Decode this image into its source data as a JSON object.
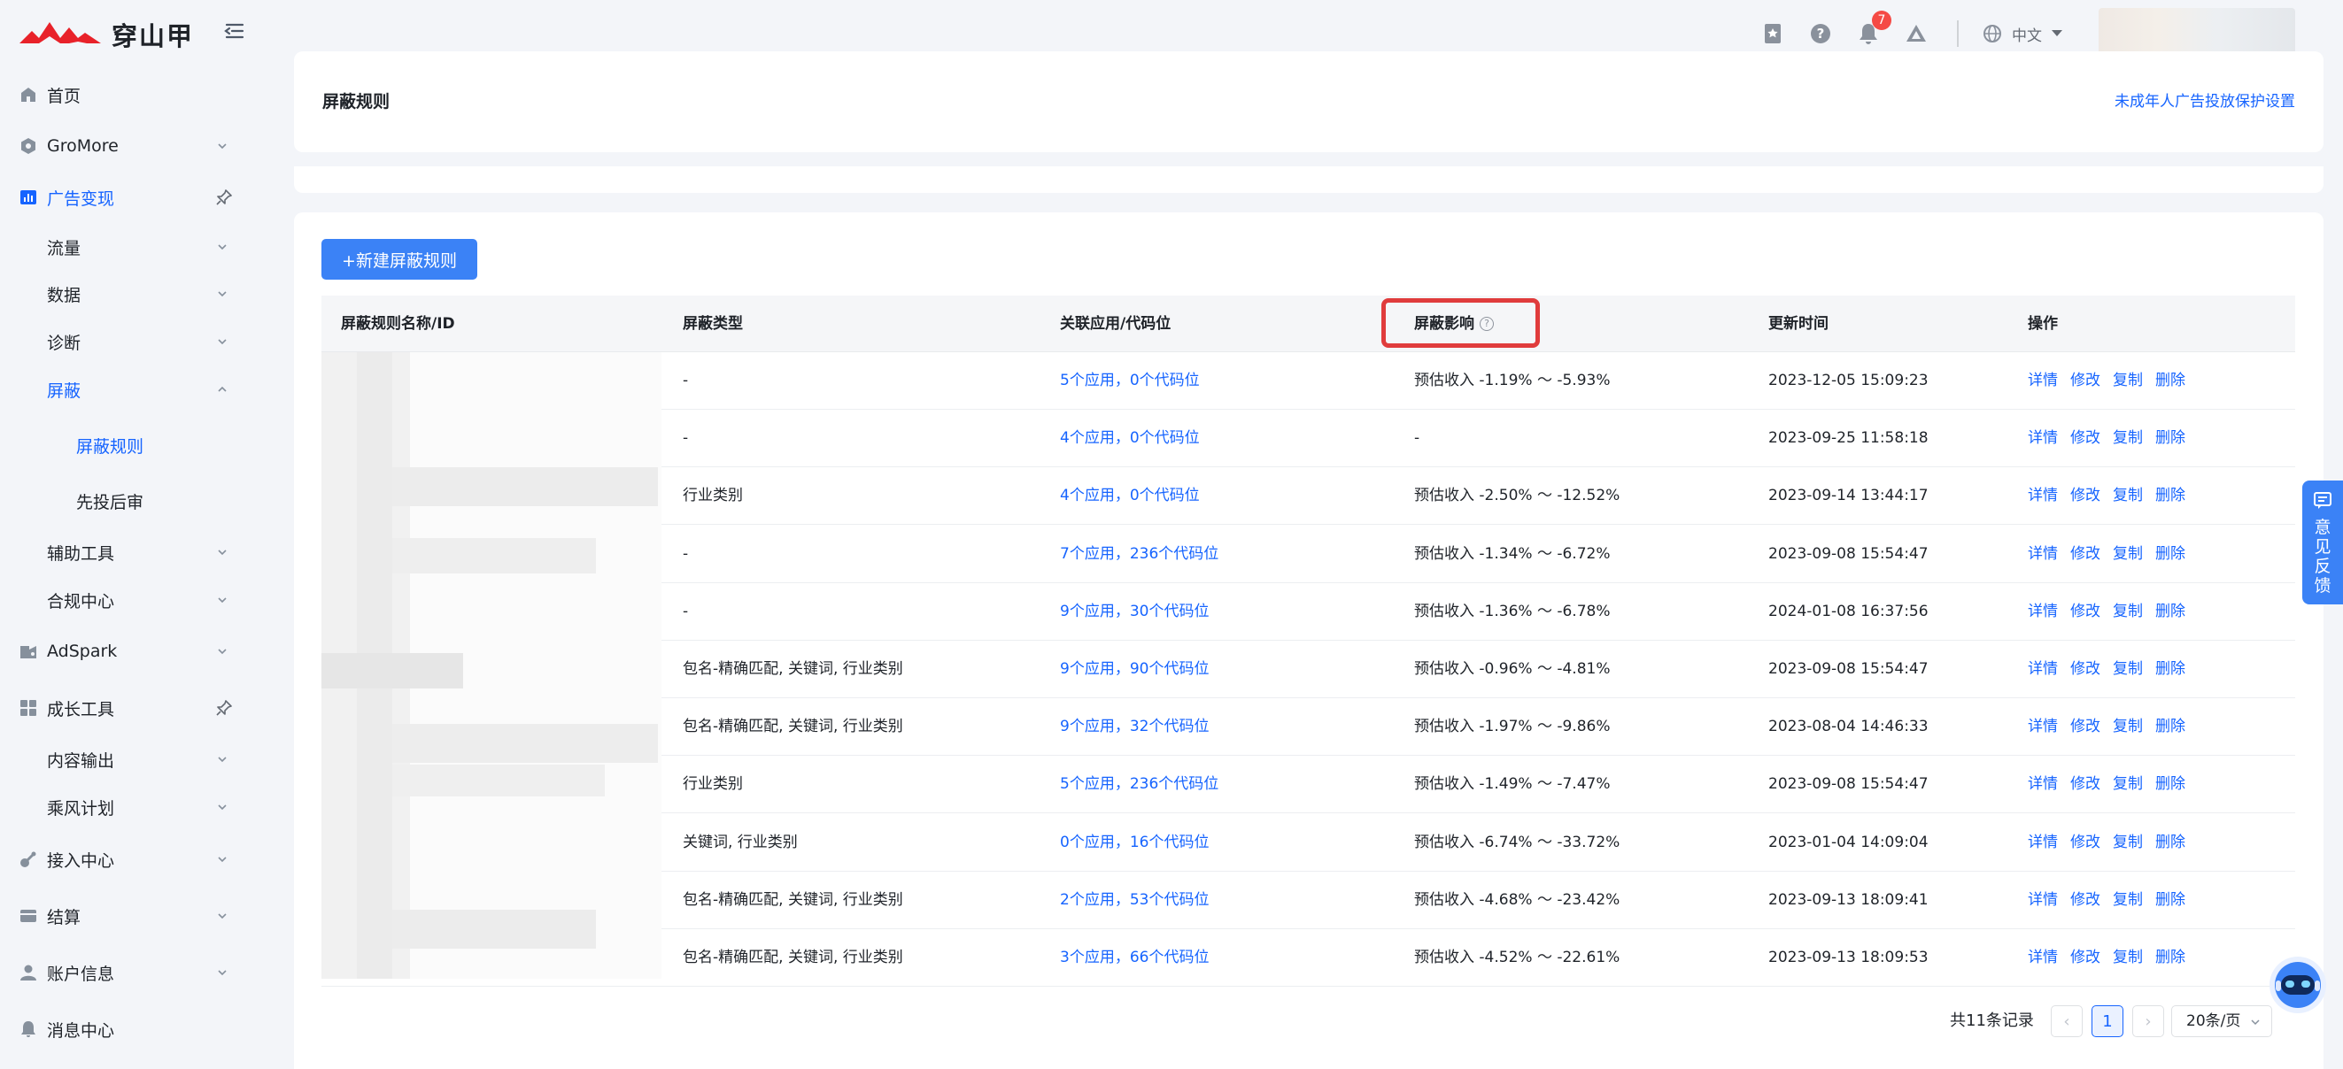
{
  "brand": {
    "name": "穿山甲",
    "accent": "#1664ff",
    "logo_color": "#e8222a"
  },
  "topbar": {
    "notification_count": "7",
    "language": "中文",
    "icons": [
      "bookmark-icon",
      "help-icon",
      "bell-icon",
      "ai-icon",
      "globe-icon"
    ]
  },
  "sidebar": {
    "items": [
      {
        "label": "首页",
        "icon": "home-icon"
      },
      {
        "label": "GroMore",
        "icon": "gromore-icon"
      },
      {
        "label": "广告变现",
        "icon": "chart-icon"
      },
      {
        "label": "流量"
      },
      {
        "label": "数据"
      },
      {
        "label": "诊断"
      },
      {
        "label": "屏蔽"
      },
      {
        "label": "屏蔽规则"
      },
      {
        "label": "先投后审"
      },
      {
        "label": "辅助工具"
      },
      {
        "label": "合规中心"
      },
      {
        "label": "AdSpark",
        "icon": "adspark-icon"
      },
      {
        "label": "成长工具",
        "icon": "grid-icon"
      },
      {
        "label": "内容输出"
      },
      {
        "label": "乘风计划"
      },
      {
        "label": "接入中心",
        "icon": "plug-icon"
      },
      {
        "label": "结算",
        "icon": "wallet-icon"
      },
      {
        "label": "账户信息",
        "icon": "user-icon"
      },
      {
        "label": "消息中心",
        "icon": "bell-icon"
      }
    ]
  },
  "header": {
    "title": "屏蔽规则",
    "link": "未成年人广告投放保护设置"
  },
  "toolbar": {
    "new_rule_label": "+新建屏蔽规则"
  },
  "table": {
    "columns": [
      "屏蔽规则名称/ID",
      "屏蔽类型",
      "关联应用/代码位",
      "屏蔽影响",
      "更新时间",
      "操作"
    ],
    "info_mark": "?",
    "actions": [
      "详情",
      "修改",
      "复制",
      "删除"
    ],
    "rows": [
      {
        "type": "-",
        "assoc": "5个应用，0个代码位",
        "impact": "预估收入 -1.19% ～ -5.93%",
        "updated": "2023-12-05 15:09:23"
      },
      {
        "type": "-",
        "assoc": "4个应用，0个代码位",
        "impact": "-",
        "updated": "2023-09-25 11:58:18"
      },
      {
        "type": "行业类别",
        "assoc": "4个应用，0个代码位",
        "impact": "预估收入 -2.50% ～ -12.52%",
        "updated": "2023-09-14 13:44:17"
      },
      {
        "type": "-",
        "assoc": "7个应用，236个代码位",
        "impact": "预估收入 -1.34% ～ -6.72%",
        "updated": "2023-09-08 15:54:47"
      },
      {
        "type": "-",
        "assoc": "9个应用，30个代码位",
        "impact": "预估收入 -1.36% ～ -6.78%",
        "updated": "2024-01-08 16:37:56"
      },
      {
        "type": "包名-精确匹配, 关键词, 行业类别",
        "assoc": "9个应用，90个代码位",
        "impact": "预估收入 -0.96% ～ -4.81%",
        "updated": "2023-09-08 15:54:47"
      },
      {
        "type": "包名-精确匹配, 关键词, 行业类别",
        "assoc": "9个应用，32个代码位",
        "impact": "预估收入 -1.97% ～ -9.86%",
        "updated": "2023-08-04 14:46:33"
      },
      {
        "type": "行业类别",
        "assoc": "5个应用，236个代码位",
        "impact": "预估收入 -1.49% ～ -7.47%",
        "updated": "2023-09-08 15:54:47"
      },
      {
        "type": "关键词, 行业类别",
        "assoc": "0个应用，16个代码位",
        "impact": "预估收入 -6.74% ～ -33.72%",
        "updated": "2023-01-04 14:09:04"
      },
      {
        "type": "包名-精确匹配, 关键词, 行业类别",
        "assoc": "2个应用，53个代码位",
        "impact": "预估收入 -4.68% ～ -23.42%",
        "updated": "2023-09-13 18:09:41"
      },
      {
        "type": "包名-精确匹配, 关键词, 行业类别",
        "assoc": "3个应用，66个代码位",
        "impact": "预估收入 -4.52% ～ -22.61%",
        "updated": "2023-09-13 18:09:53"
      }
    ]
  },
  "pagination": {
    "total": "共11条记录",
    "prev": "‹",
    "current_page": "1",
    "next": "›",
    "page_size": "20条/页"
  },
  "feedback": {
    "label": "意见反馈"
  }
}
